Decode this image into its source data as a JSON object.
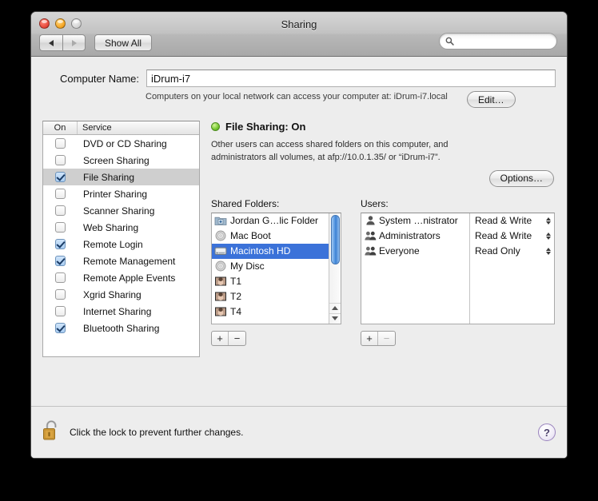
{
  "window": {
    "title": "Sharing",
    "traffic_lights": [
      "close-button",
      "minimize-button",
      "zoom-button"
    ]
  },
  "toolbar": {
    "back_label": "◀",
    "forward_label": "▶",
    "show_all_label": "Show All",
    "search_placeholder": "",
    "search_value": ""
  },
  "computer_name": {
    "label": "Computer Name:",
    "value": "iDrum-i7",
    "hint": "Computers on your local network can access your computer at: iDrum-i7.local",
    "edit_label": "Edit…"
  },
  "services": {
    "header_on": "On",
    "header_service": "Service",
    "items": [
      {
        "label": "DVD or CD Sharing",
        "on": false,
        "selected": false
      },
      {
        "label": "Screen Sharing",
        "on": false,
        "selected": false
      },
      {
        "label": "File Sharing",
        "on": true,
        "selected": true
      },
      {
        "label": "Printer Sharing",
        "on": false,
        "selected": false
      },
      {
        "label": "Scanner Sharing",
        "on": false,
        "selected": false
      },
      {
        "label": "Web Sharing",
        "on": false,
        "selected": false
      },
      {
        "label": "Remote Login",
        "on": true,
        "selected": false
      },
      {
        "label": "Remote Management",
        "on": true,
        "selected": false
      },
      {
        "label": "Remote Apple Events",
        "on": false,
        "selected": false
      },
      {
        "label": "Xgrid Sharing",
        "on": false,
        "selected": false
      },
      {
        "label": "Internet Sharing",
        "on": false,
        "selected": false
      },
      {
        "label": "Bluetooth Sharing",
        "on": true,
        "selected": false
      }
    ]
  },
  "detail": {
    "status_title": "File Sharing: On",
    "status_color": "#74c730",
    "description": "Other users can access shared folders on this computer, and administrators all volumes, at afp://10.0.1.35/ or “iDrum-i7”.",
    "options_label": "Options…"
  },
  "shared_folders": {
    "title": "Shared Folders:",
    "items": [
      {
        "label": "Jordan G…lic Folder",
        "icon": "public-folder-icon",
        "selected": false
      },
      {
        "label": "Mac Boot",
        "icon": "disc-icon",
        "selected": false
      },
      {
        "label": "Macintosh HD",
        "icon": "hard-drive-icon",
        "selected": true
      },
      {
        "label": "My Disc",
        "icon": "disc-icon",
        "selected": false
      },
      {
        "label": "T1",
        "icon": "photo-icon",
        "selected": false
      },
      {
        "label": "T2",
        "icon": "photo-icon",
        "selected": false
      },
      {
        "label": "T4",
        "icon": "photo-icon",
        "selected": false
      }
    ],
    "add_label": "+",
    "remove_label": "−"
  },
  "users": {
    "title": "Users:",
    "items": [
      {
        "name": "System …nistrator",
        "permission": "Read & Write",
        "icon": "single-user-icon"
      },
      {
        "name": "Administrators",
        "permission": "Read & Write",
        "icon": "group-users-icon"
      },
      {
        "name": "Everyone",
        "permission": "Read Only",
        "icon": "group-users-icon"
      }
    ],
    "add_label": "+",
    "remove_label": "−"
  },
  "footer": {
    "lock_text": "Click the lock to prevent further changes.",
    "lock_state": "unlocked",
    "help_label": "?"
  }
}
